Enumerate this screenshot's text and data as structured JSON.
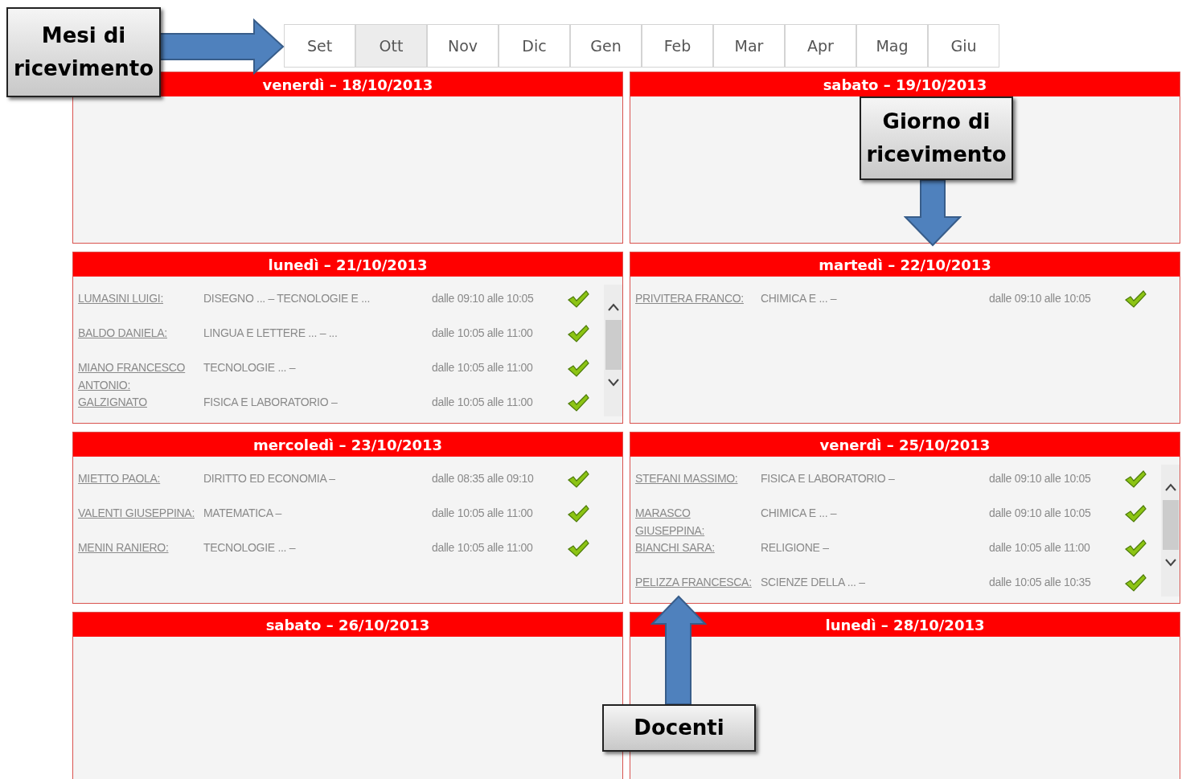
{
  "months": [
    {
      "label": "Set",
      "selected": false
    },
    {
      "label": "Ott",
      "selected": true
    },
    {
      "label": "Nov",
      "selected": false
    },
    {
      "label": "Dic",
      "selected": false
    },
    {
      "label": "Gen",
      "selected": false
    },
    {
      "label": "Feb",
      "selected": false
    },
    {
      "label": "Mar",
      "selected": false
    },
    {
      "label": "Apr",
      "selected": false
    },
    {
      "label": "Mag",
      "selected": false
    },
    {
      "label": "Giu",
      "selected": false
    }
  ],
  "days": [
    {
      "title": "venerdì – 18/10/2013",
      "scrollable": false
    },
    {
      "title": "sabato – 19/10/2013",
      "scrollable": false
    },
    {
      "title": "lunedì – 21/10/2013",
      "scrollable": true,
      "teachers": [
        {
          "name": "LUMASINI LUIGI:",
          "subjects": "DISEGNO ... – TECNOLOGIE E ...",
          "time": "dalle 09:10 alle 10:05"
        },
        {
          "name": "BALDO DANIELA:",
          "subjects": "LINGUA E LETTERE ... – ...",
          "time": "dalle 10:05 alle 11:00"
        },
        {
          "name": "MIANO FRANCESCO ANTONIO:",
          "subjects": "TECNOLOGIE ... –",
          "time": "dalle 10:05 alle 11:00"
        },
        {
          "name": "GALZIGNATO",
          "subjects": "FISICA E LABORATORIO –",
          "time": "dalle 10:05 alle 11:00"
        }
      ]
    },
    {
      "title": "martedì – 22/10/2013",
      "scrollable": false,
      "teachers": [
        {
          "name": "PRIVITERA FRANCO:",
          "subjects": "CHIMICA E ... –",
          "time": "dalle 09:10 alle 10:05"
        }
      ]
    },
    {
      "title": "mercoledì – 23/10/2013",
      "scrollable": false,
      "teachers": [
        {
          "name": "MIETTO PAOLA:",
          "subjects": "DIRITTO ED ECONOMIA –",
          "time": "dalle 08:35 alle 09:10"
        },
        {
          "name": "VALENTI GIUSEPPINA:",
          "subjects": "MATEMATICA –",
          "time": "dalle 10:05 alle 11:00"
        },
        {
          "name": "MENIN RANIERO:",
          "subjects": "TECNOLOGIE ... –",
          "time": "dalle 10:05 alle 11:00"
        }
      ]
    },
    {
      "title": "venerdì – 25/10/2013",
      "scrollable": true,
      "teachers": [
        {
          "name": "STEFANI MASSIMO:",
          "subjects": "FISICA E LABORATORIO –",
          "time": "dalle 09:10 alle 10:05"
        },
        {
          "name": "MARASCO GIUSEPPINA:",
          "subjects": "CHIMICA E ... –",
          "time": "dalle 09:10 alle 10:05"
        },
        {
          "name": "BIANCHI SARA:",
          "subjects": "RELIGIONE –",
          "time": "dalle 10:05 alle 11:00"
        },
        {
          "name": "PELIZZA FRANCESCA:",
          "subjects": "SCIENZE DELLA ... –",
          "time": "dalle 10:05 alle 10:35"
        }
      ]
    },
    {
      "title": "sabato – 26/10/2013",
      "scrollable": false
    },
    {
      "title": "lunedì – 28/10/2013",
      "scrollable": false
    }
  ],
  "annotations": [
    {
      "text": "Mesi di ricevimento",
      "kind": "right"
    },
    {
      "text": "Giorno di ricevimento",
      "kind": "down"
    },
    {
      "text": "Docenti",
      "kind": "up"
    }
  ]
}
